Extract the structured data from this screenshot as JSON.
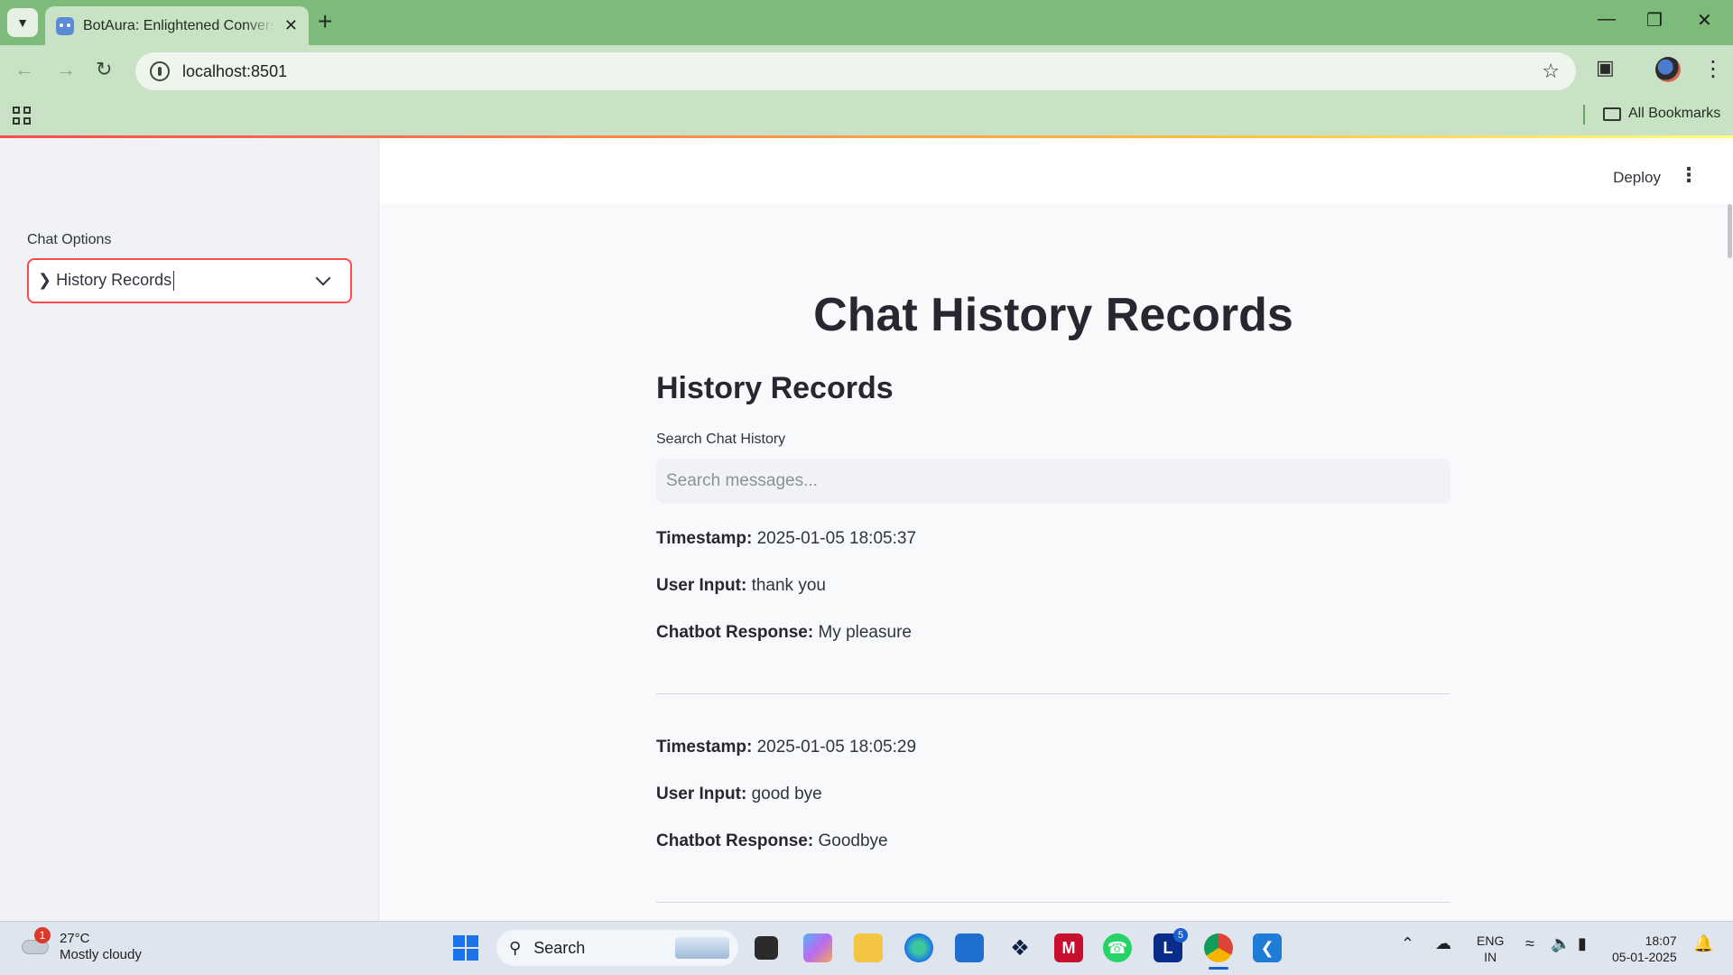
{
  "browser": {
    "tab_title": "BotAura: Enlightened Conversations",
    "url": "localhost:8501",
    "bookmarks_label": "All Bookmarks"
  },
  "app": {
    "deploy_label": "Deploy",
    "sidebar": {
      "label": "Chat Options",
      "selected_option": "History Records"
    },
    "page_title": "Chat History Records",
    "section_title": "History Records",
    "search": {
      "label": "Search Chat History",
      "placeholder": "Search messages...",
      "value": ""
    },
    "field_labels": {
      "timestamp": "Timestamp:",
      "user_input": "User Input:",
      "chatbot_response": "Chatbot Response:"
    },
    "records": [
      {
        "timestamp": "2025-01-05 18:05:37",
        "user_input": "thank you",
        "chatbot_response": "My pleasure"
      },
      {
        "timestamp": "2025-01-05 18:05:29",
        "user_input": "good bye",
        "chatbot_response": "Goodbye"
      }
    ]
  },
  "taskbar": {
    "weather": {
      "badge": "1",
      "temp": "27°C",
      "condition": "Mostly cloudy"
    },
    "search_label": "Search",
    "linkedin_badge": "5",
    "lang_line1": "ENG",
    "lang_line2": "IN",
    "time": "18:07",
    "date": "05-01-2025"
  },
  "colors": {
    "accent": "#ff4b4b",
    "browser_frame": "#7dbb7a",
    "browser_toolbar": "#c9e2c5"
  }
}
